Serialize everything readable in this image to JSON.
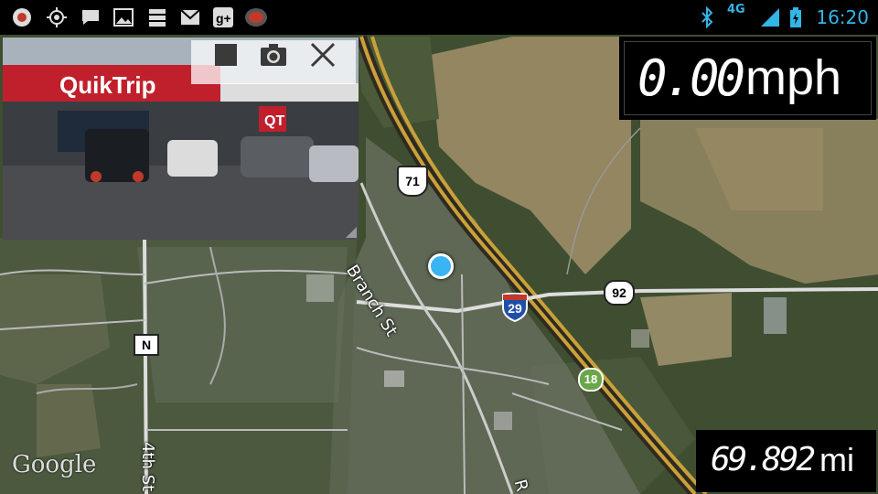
{
  "status_bar": {
    "left_icons": [
      "record-icon",
      "gps-icon",
      "chat-icon",
      "gallery-icon",
      "storage-icon",
      "gmail-icon",
      "google-plus-icon",
      "app-icon"
    ],
    "right_icons": [
      "bluetooth-icon",
      "network-icon",
      "signal-icon",
      "battery-charging-icon"
    ],
    "network": "4G",
    "time": "16:20"
  },
  "camera_preview": {
    "store_sign": "QuikTrip",
    "store_logo": "QT",
    "buttons": [
      "stop-icon",
      "camera-icon",
      "close-icon"
    ]
  },
  "speedometer": {
    "value": "0.00",
    "unit": "mph"
  },
  "odometer": {
    "value": "69.892",
    "unit": "mi"
  },
  "map": {
    "road_labels": {
      "branch_st": "Branch St",
      "fourth_st": "4th St",
      "r_street": "R"
    },
    "shields": {
      "us_71": "71",
      "route_92": "92",
      "i_29": "29",
      "n": "N",
      "route_18": "18"
    },
    "attribution": "Google",
    "colors": {
      "location_dot": "#3ab4f2",
      "highway": "#c9a03a"
    }
  }
}
